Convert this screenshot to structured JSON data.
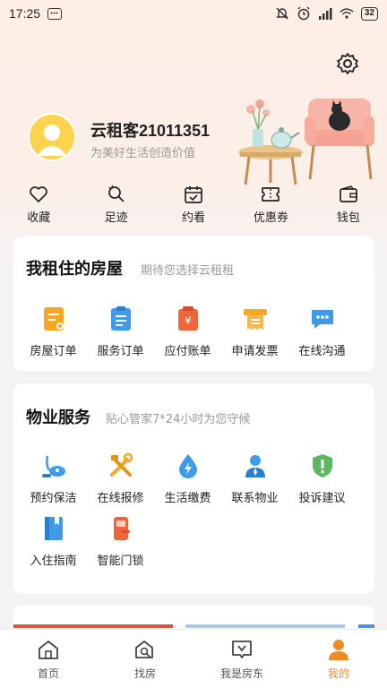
{
  "status_bar": {
    "time": "17:25",
    "battery": "32"
  },
  "profile": {
    "username": "云租客21011351",
    "slogan": "为美好生活创造价值"
  },
  "quick_actions": [
    {
      "label": "收藏",
      "icon": "heart-icon"
    },
    {
      "label": "足迹",
      "icon": "footprint-icon"
    },
    {
      "label": "约看",
      "icon": "calendar-icon"
    },
    {
      "label": "优惠券",
      "icon": "coupon-icon"
    },
    {
      "label": "钱包",
      "icon": "wallet-icon"
    }
  ],
  "housing_card": {
    "title": "我租住的房屋",
    "subtitle": "期待您选择云租租",
    "items": [
      {
        "label": "房屋订单",
        "icon": "house-order-icon",
        "color": "#f5a623"
      },
      {
        "label": "服务订单",
        "icon": "service-order-icon",
        "color": "#3d9be9"
      },
      {
        "label": "应付账单",
        "icon": "bill-icon",
        "color": "#f0643c"
      },
      {
        "label": "申请发票",
        "icon": "invoice-icon",
        "color": "#f5a623"
      },
      {
        "label": "在线沟通",
        "icon": "chat-icon",
        "color": "#3d9be9"
      }
    ]
  },
  "property_card": {
    "title": "物业服务",
    "subtitle": "贴心管家7*24小时为您守候",
    "items": [
      {
        "label": "预约保洁",
        "icon": "vacuum-icon",
        "color": "#3d9be9"
      },
      {
        "label": "在线报修",
        "icon": "repair-tools-icon",
        "color": "#f5a623"
      },
      {
        "label": "生活缴费",
        "icon": "utility-drop-icon",
        "color": "#3d9be9"
      },
      {
        "label": "联系物业",
        "icon": "staff-icon",
        "color": "#3d9be9"
      },
      {
        "label": "投诉建议",
        "icon": "shield-alert-icon",
        "color": "#5cb85c"
      },
      {
        "label": "入住指南",
        "icon": "guide-book-icon",
        "color": "#3d9be9"
      },
      {
        "label": "智能门锁",
        "icon": "smart-lock-icon",
        "color": "#f0643c"
      }
    ]
  },
  "bottom_nav": [
    {
      "label": "首页",
      "icon": "home-icon",
      "active": false
    },
    {
      "label": "找房",
      "icon": "find-house-icon",
      "active": false
    },
    {
      "label": "我是房东",
      "icon": "landlord-icon",
      "active": false
    },
    {
      "label": "我的",
      "icon": "profile-icon",
      "active": true
    }
  ],
  "colors": {
    "accent": "#f08a22",
    "header_bg": "#fdeee6",
    "avatar": "#ffd34d"
  }
}
